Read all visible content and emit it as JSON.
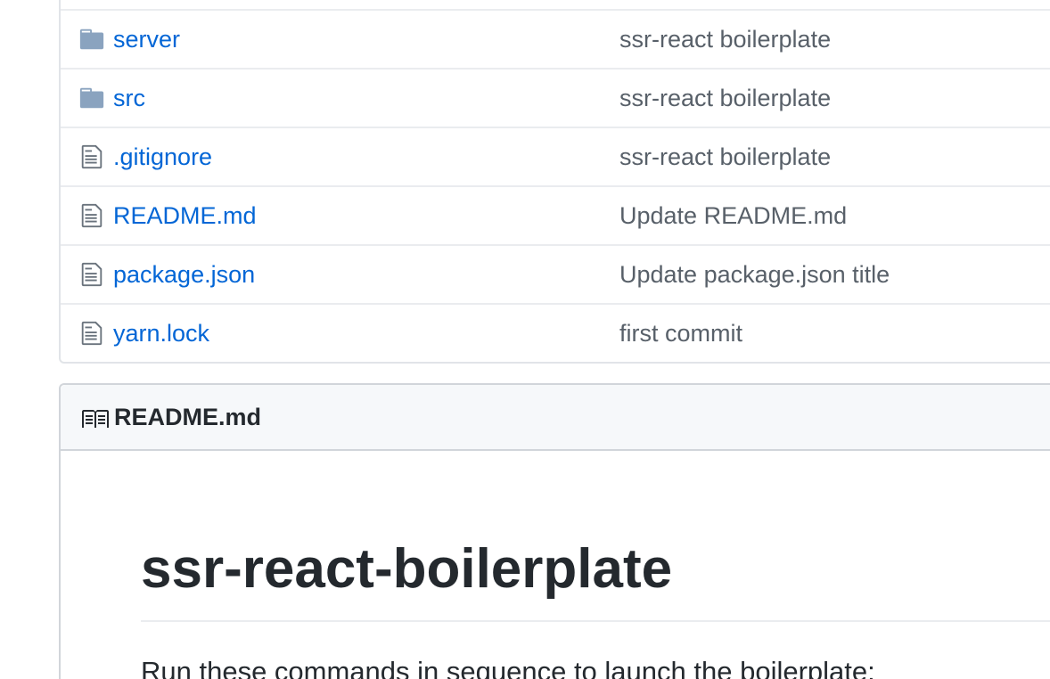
{
  "files": [
    {
      "name": "server",
      "type": "folder",
      "icon": "folder-icon",
      "message": "ssr-react boilerplate"
    },
    {
      "name": "src",
      "type": "folder",
      "icon": "folder-icon",
      "message": "ssr-react boilerplate"
    },
    {
      "name": ".gitignore",
      "type": "file",
      "icon": "file-icon",
      "message": "ssr-react boilerplate"
    },
    {
      "name": "README.md",
      "type": "file",
      "icon": "file-icon",
      "message": "Update README.md"
    },
    {
      "name": "package.json",
      "type": "file",
      "icon": "file-icon",
      "message": "Update package.json title"
    },
    {
      "name": "yarn.lock",
      "type": "file",
      "icon": "file-icon",
      "message": "first commit"
    }
  ],
  "readme": {
    "icon": "book-icon",
    "header_title": "README.md",
    "heading": "ssr-react-boilerplate",
    "intro": "Run these commands in sequence to launch the boilerplate:"
  },
  "colors": {
    "link": "#0366d6",
    "muted": "#586069",
    "folder": "#79b8ff",
    "text": "#24292e"
  }
}
